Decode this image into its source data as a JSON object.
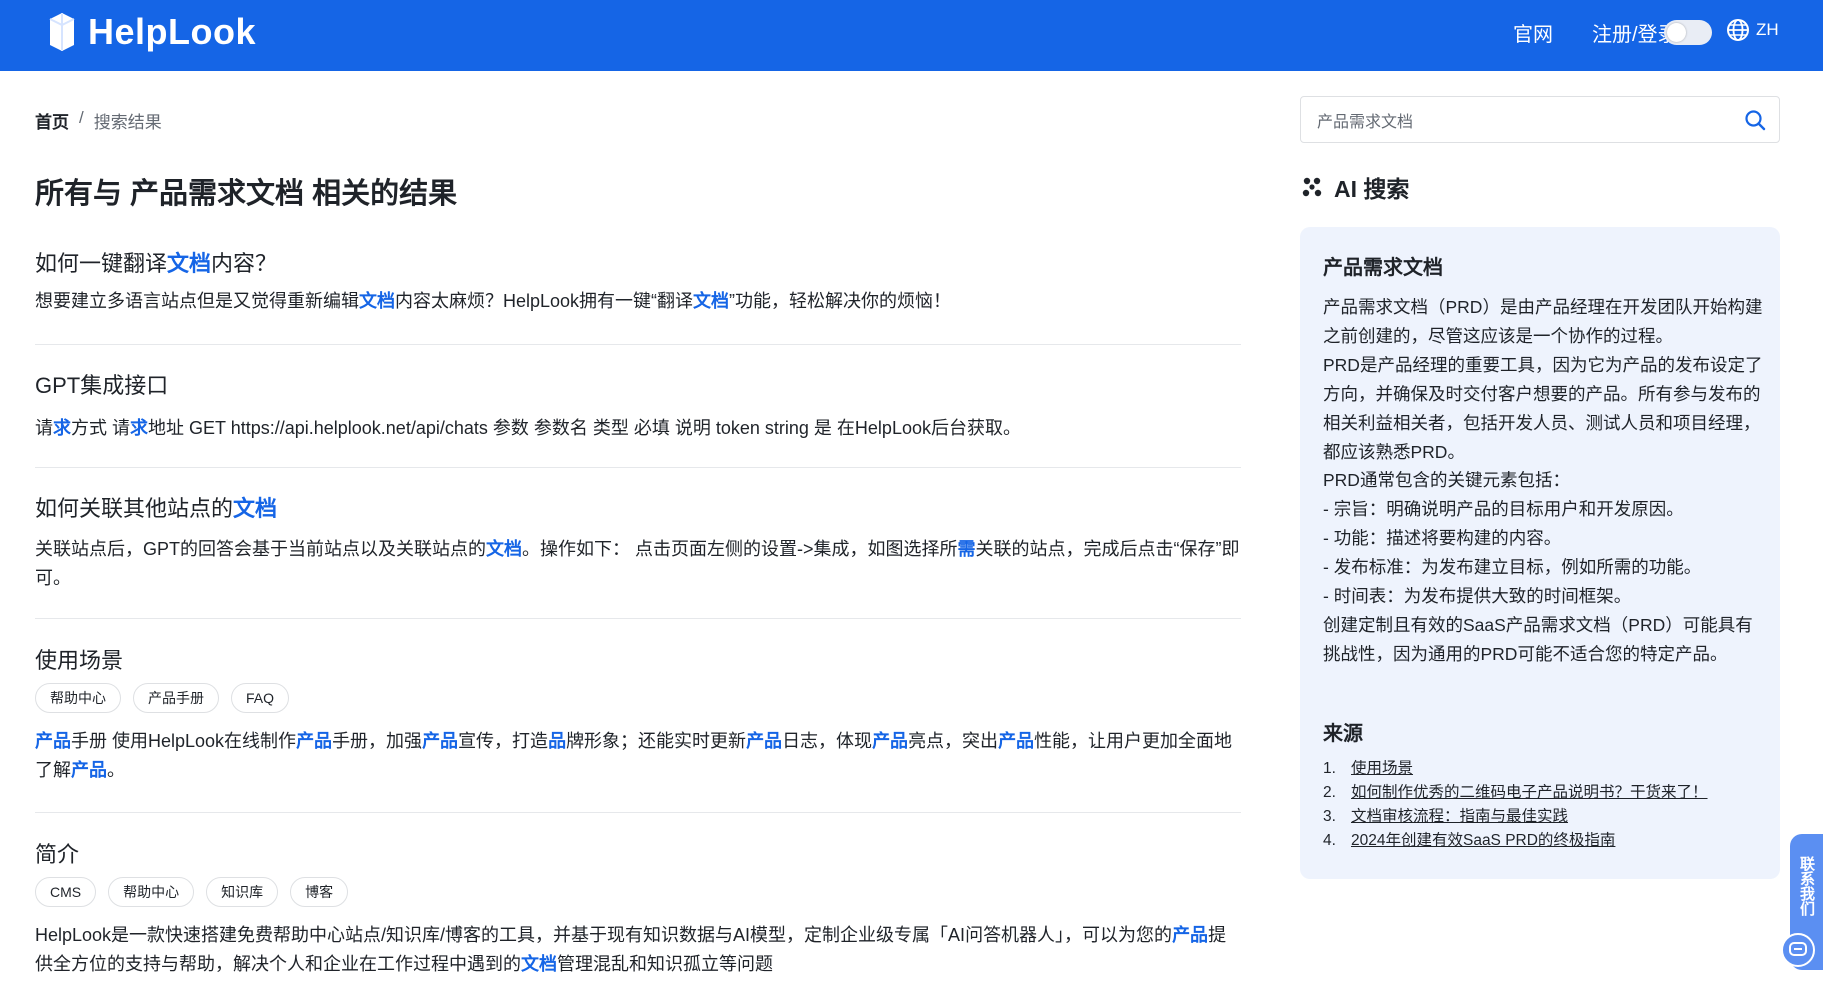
{
  "header": {
    "logo_text": "HelpLook",
    "nav": [
      {
        "label": "官网"
      },
      {
        "label": "注册/登录"
      }
    ],
    "lang_label": "ZH",
    "theme_toggle_on": false
  },
  "breadcrumb": {
    "home": "首页",
    "separator": "/",
    "current": "搜索结果"
  },
  "page_title": "所有与 产品需求文档 相关的结果",
  "results": [
    {
      "title": [
        {
          "t": "如何一键翻译",
          "hl": false
        },
        {
          "t": "文档",
          "hl": true
        },
        {
          "t": "内容？",
          "hl": false
        }
      ],
      "tags": [],
      "snippet": [
        {
          "t": "想要建立多语言站点但是又觉得重新编辑",
          "hl": false
        },
        {
          "t": "文档",
          "hl": true
        },
        {
          "t": "内容太麻烦？HelpLook拥有一键“翻译",
          "hl": false
        },
        {
          "t": "文档",
          "hl": true
        },
        {
          "t": "”功能，轻松解决你的烦恼！",
          "hl": false
        }
      ]
    },
    {
      "title": [
        {
          "t": "GPT集成接口",
          "hl": false
        }
      ],
      "tags": [],
      "snippet": [
        {
          "t": "请",
          "hl": false
        },
        {
          "t": "求",
          "hl": true
        },
        {
          "t": "方式 请",
          "hl": false
        },
        {
          "t": "求",
          "hl": true
        },
        {
          "t": "地址 GET https://api.helplook.net/api/chats 参数 参数名 类型 必填 说明 token string 是 在HelpLook后台获取。",
          "hl": false
        }
      ]
    },
    {
      "title": [
        {
          "t": "如何关联其他站点的",
          "hl": false
        },
        {
          "t": "文档",
          "hl": true
        }
      ],
      "tags": [],
      "snippet": [
        {
          "t": "关联站点后，GPT的回答会基于当前站点以及关联站点的",
          "hl": false
        },
        {
          "t": "文档",
          "hl": true
        },
        {
          "t": "。操作如下： 点击页面左侧的设置->集成，如图选择所",
          "hl": false
        },
        {
          "t": "需",
          "hl": true
        },
        {
          "t": "关联的站点，完成后点击“保存”即可。",
          "hl": false
        }
      ]
    },
    {
      "title": [
        {
          "t": "使用场景",
          "hl": false
        }
      ],
      "tags": [
        "帮助中心",
        "产品手册",
        "FAQ"
      ],
      "snippet": [
        {
          "t": "产品",
          "hl": true
        },
        {
          "t": "手册 使用HelpLook在线制作",
          "hl": false
        },
        {
          "t": "产品",
          "hl": true
        },
        {
          "t": "手册，加强",
          "hl": false
        },
        {
          "t": "产品",
          "hl": true
        },
        {
          "t": "宣传，打造",
          "hl": false
        },
        {
          "t": "品",
          "hl": true
        },
        {
          "t": "牌形象；还能实时更新",
          "hl": false
        },
        {
          "t": "产品",
          "hl": true
        },
        {
          "t": "日志，体现",
          "hl": false
        },
        {
          "t": "产品",
          "hl": true
        },
        {
          "t": "亮点，突出",
          "hl": false
        },
        {
          "t": "产品",
          "hl": true
        },
        {
          "t": "性能，让用户更加全面地了解",
          "hl": false
        },
        {
          "t": "产品",
          "hl": true
        },
        {
          "t": "。",
          "hl": false
        }
      ]
    },
    {
      "title": [
        {
          "t": "简介",
          "hl": false
        }
      ],
      "tags": [
        "CMS",
        "帮助中心",
        "知识库",
        "博客"
      ],
      "snippet": [
        {
          "t": "HelpLook是一款快速搭建免费帮助中心站点/知识库/博客的工具，并基于现有知识数据与AI模型，定制企业级专属「AI问答机器人」，可以为您的",
          "hl": false
        },
        {
          "t": "产品",
          "hl": true
        },
        {
          "t": "提供全方位的支持与帮助，解决个人和企业在工作过程中遇到的",
          "hl": false
        },
        {
          "t": "文档",
          "hl": true
        },
        {
          "t": "管理混乱和知识孤立等问题",
          "hl": false
        }
      ]
    }
  ],
  "search": {
    "value": "产品需求文档",
    "placeholder": ""
  },
  "ai": {
    "heading": "AI 搜索",
    "card_title": "产品需求文档",
    "body": [
      "产品需求文档（PRD）是由产品经理在开发团队开始构建之前创建的，尽管这应该是一个协作的过程。",
      "PRD是产品经理的重要工具，因为它为产品的发布设定了方向，并确保及时交付客户想要的产品。所有参与发布的相关利益相关者，包括开发人员、测试人员和项目经理，都应该熟悉PRD。",
      "PRD通常包含的关键元素包括：",
      "- 宗旨：明确说明产品的目标用户和开发原因。",
      "- 功能：描述将要构建的内容。",
      "- 发布标准：为发布建立目标，例如所需的功能。",
      "- 时间表：为发布提供大致的时间框架。",
      "创建定制且有效的SaaS产品需求文档（PRD）可能具有挑战性，因为通用的PRD可能不适合您的特定产品。"
    ],
    "sources_label": "来源",
    "sources": [
      {
        "num": "1.",
        "label": "使用场景"
      },
      {
        "num": "2.",
        "label": "如何制作优秀的二维码电子产品说明书？干货来了！"
      },
      {
        "num": "3.",
        "label": "文档审核流程：指南与最佳实践"
      },
      {
        "num": "4.",
        "label": "2024年创建有效SaaS PRD的终极指南"
      }
    ]
  },
  "contact": {
    "label": "联系我们"
  },
  "colors": {
    "brand": "#1565e6",
    "highlight": "#1565e6",
    "ai_card_bg": "#eef3fd",
    "contact_tab": "#5b8ff2"
  },
  "icons": [
    "logo-cube-icon",
    "globe-icon",
    "search-icon",
    "ai-sparkle-icon",
    "chat-icon"
  ]
}
